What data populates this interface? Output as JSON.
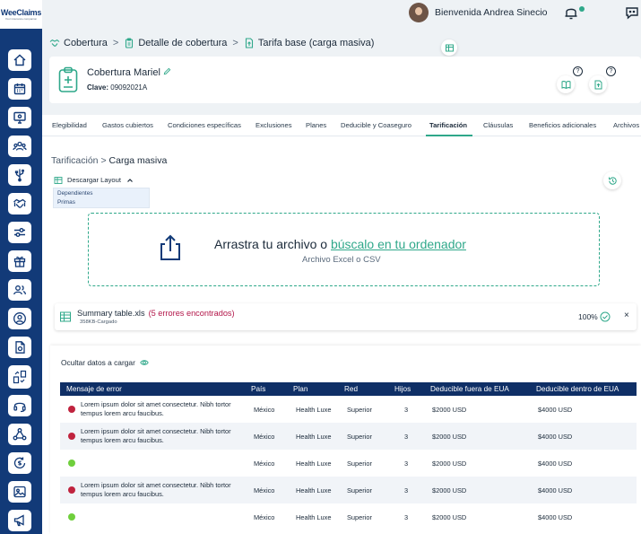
{
  "brand": {
    "name": "WeeClaims",
    "tagline": "Your insurance companion"
  },
  "topbar": {
    "welcome": "Bienvenida Andrea Sinecio"
  },
  "breadcrumb": {
    "items": [
      "Cobertura",
      "Detalle de cobertura",
      "Tarifa base (carga masiva)"
    ]
  },
  "coverage": {
    "name": "Cobertura Mariel",
    "key_label": "Clave:",
    "key_value": "09092021A"
  },
  "help_badges": [
    "?",
    "?"
  ],
  "tabs": [
    {
      "label": "Elegibilidad"
    },
    {
      "label": "Gastos cubiertos"
    },
    {
      "label": "Condiciones específicas"
    },
    {
      "label": "Exclusiones"
    },
    {
      "label": "Planes"
    },
    {
      "label": "Deducible y Coaseguro"
    },
    {
      "label": "Tarificación",
      "active": true
    },
    {
      "label": "Cláusulas"
    },
    {
      "label": "Beneficios adicionales"
    },
    {
      "label": "Archivos"
    }
  ],
  "sub_breadcrumb": {
    "parent": "Tarificación",
    "current": "Carga masiva"
  },
  "download_layout": {
    "label": "Descargar Layout",
    "options": [
      "Dependientes",
      "Primas"
    ]
  },
  "upload": {
    "title_prefix": "Arrastra tu archivo o",
    "title_link": "búscalo en tu ordenador",
    "subtitle": "Archivo Excel o CSV"
  },
  "file": {
    "name": "Summary table.xls",
    "errors": "(5 errores encontrados)",
    "meta": "358KB-Cargado",
    "progress": "100%",
    "close": "×"
  },
  "data_toggle": {
    "label": "Ocultar datos a cargar"
  },
  "table": {
    "columns": [
      "Mensaje de error",
      "País",
      "Plan",
      "Red",
      "Hijos",
      "Deducible fuera de EUA",
      "Deducible dentro de EUA"
    ],
    "rows": [
      {
        "status": "error",
        "message": "Lorem ipsum dolor sit amet consectetur. Nibh tortor tempus lorem arcu faucibus.",
        "pais": "México",
        "plan": "Health Luxe",
        "red": "Superior",
        "hijos": "3",
        "fuera": "$2000 USD",
        "dentro": "$4000 USD"
      },
      {
        "status": "error",
        "message": "Lorem ipsum dolor sit amet consectetur. Nibh tortor tempus lorem arcu faucibus.",
        "pais": "México",
        "plan": "Health Luxe",
        "red": "Superior",
        "hijos": "3",
        "fuera": "$2000 USD",
        "dentro": "$4000 USD"
      },
      {
        "status": "ok",
        "message": "",
        "pais": "México",
        "plan": "Health Luxe",
        "red": "Superior",
        "hijos": "3",
        "fuera": "$2000 USD",
        "dentro": "$4000 USD"
      },
      {
        "status": "error",
        "message": "Lorem ipsum dolor sit amet consectetur. Nibh tortor tempus lorem arcu faucibus.",
        "pais": "México",
        "plan": "Health Luxe",
        "red": "Superior",
        "hijos": "3",
        "fuera": "$2000 USD",
        "dentro": "$4000 USD"
      },
      {
        "status": "ok",
        "message": "",
        "pais": "México",
        "plan": "Health Luxe",
        "red": "Superior",
        "hijos": "3",
        "fuera": "$2000 USD",
        "dentro": "$4000 USD"
      }
    ]
  },
  "sidebar_icons": [
    "home-icon",
    "calendar-icon",
    "monitor-icon",
    "users-group-icon",
    "usb-icon",
    "handshake-icon",
    "sliders-icon",
    "gift-box-icon",
    "user-pair-icon",
    "user-circle-icon",
    "document-icon",
    "file-transfer-icon",
    "headset-icon",
    "network-icon",
    "money-refresh-icon",
    "photo-icon",
    "megaphone-icon"
  ],
  "colors": {
    "sidebar": "#123a78",
    "accent": "#2fa88a",
    "table_header": "#0f2f66",
    "error_dot": "#c0233e",
    "ok_dot": "#6fcf3c",
    "error_text": "#b3174a"
  }
}
